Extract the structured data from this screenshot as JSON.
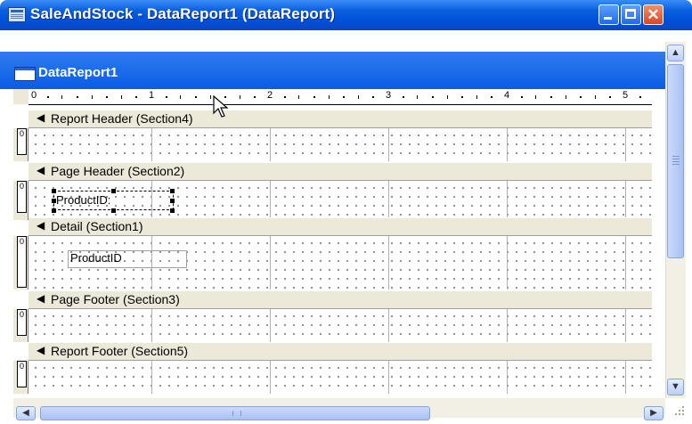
{
  "window": {
    "title": "SaleAndStock - DataReport1 (DataReport)",
    "colors": {
      "titlebar": "#0a5fe0",
      "close_button": "#d64a22",
      "section_bar": "#ece9d8"
    }
  },
  "inner_window": {
    "title": "DataReport1"
  },
  "ruler": {
    "numbers": [
      "0",
      "1",
      "2",
      "3",
      "4",
      "5"
    ]
  },
  "sections": [
    {
      "caption": "Report Header (Section4)",
      "vruler_label": "0"
    },
    {
      "caption": "Page Header (Section2)",
      "vruler_label": "0",
      "controls": [
        {
          "kind": "label",
          "text": "ProductID:",
          "selected": true
        }
      ]
    },
    {
      "caption": "Detail (Section1)",
      "vruler_label": "0",
      "controls": [
        {
          "kind": "textbox",
          "text": "ProductID"
        }
      ]
    },
    {
      "caption": "Page Footer (Section3)",
      "vruler_label": "0"
    },
    {
      "caption": "Report Footer (Section5)",
      "vruler_label": "0"
    }
  ],
  "icons": {
    "collapse": "section-arrow-icon",
    "app": "app-icon"
  }
}
